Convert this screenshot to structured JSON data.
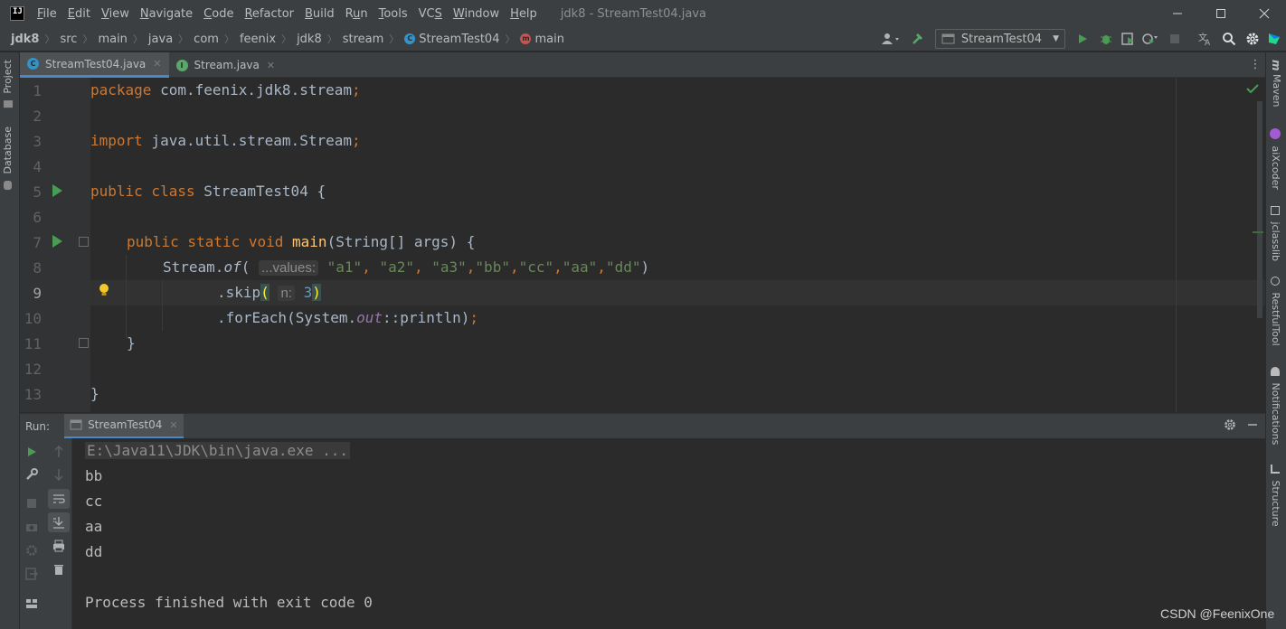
{
  "menubar": {
    "logo": "IJ",
    "items": [
      "File",
      "Edit",
      "View",
      "Navigate",
      "Code",
      "Refactor",
      "Build",
      "Run",
      "Tools",
      "VCS",
      "Window",
      "Help"
    ],
    "mnemonics": [
      "F",
      "E",
      "V",
      "N",
      "C",
      "R",
      "B",
      "u",
      "T",
      "S",
      "W",
      "H"
    ],
    "window_title": "jdk8 - StreamTest04.java"
  },
  "breadcrumb": [
    "jdk8",
    "src",
    "main",
    "java",
    "com",
    "feenix",
    "jdk8",
    "stream",
    "StreamTest04",
    "main"
  ],
  "toolbar": {
    "run_config": "StreamTest04"
  },
  "left_stripe": {
    "project": "Project",
    "database": "Database"
  },
  "right_stripe": {
    "maven": "Maven",
    "aixcoder": "aiXcoder",
    "jclasslib": "jclasslib",
    "restful": "RestfulTool",
    "notifications": "Notifications",
    "structure": "Structure"
  },
  "editor_tabs": [
    {
      "label": "StreamTest04.java",
      "icon": "class-icon",
      "active": true
    },
    {
      "label": "Stream.java",
      "icon": "interface-icon",
      "active": false
    }
  ],
  "code": {
    "line_numbers": [
      "1",
      "2",
      "3",
      "4",
      "5",
      "6",
      "7",
      "8",
      "9",
      "10",
      "11",
      "12",
      "13"
    ],
    "l1_kw": "package",
    "l1_rest": " com.feenix.jdk8.stream",
    "l1_semi": ";",
    "l3_kw": "import",
    "l3_rest": " java.util.stream.Stream",
    "l3_semi": ";",
    "l5_kw": "public class",
    "l5_rest": " StreamTest04 {",
    "l7_kw": "public static void",
    "l7_fn": "main",
    "l7_rest": "(String[] args) {",
    "l8_a": "Stream.",
    "l8_of": "of",
    "l8_paren": "(",
    "l8_hint": "...values:",
    "l8_s1": "\"a1\"",
    "l8_c1": ", ",
    "l8_s2": "\"a2\"",
    "l8_c2": ", ",
    "l8_s3": "\"a3\"",
    "l8_c3": ",",
    "l8_s4": "\"bb\"",
    "l8_c4": ",",
    "l8_s5": "\"cc\"",
    "l8_c5": ",",
    "l8_s6": "\"aa\"",
    "l8_c6": ",",
    "l8_s7": "\"dd\"",
    "l8_end": ")",
    "l9_a": ".skip",
    "l9_open": "(",
    "l9_hint": "n:",
    "l9_num": "3",
    "l9_close": ")",
    "l10_a": ".forEach(System.",
    "l10_out": "out",
    "l10_b": "::println)",
    "l10_semi": ";",
    "l11": "}",
    "l13": "}"
  },
  "run_panel": {
    "label": "Run:",
    "tab": "StreamTest04",
    "console": [
      "E:\\Java11\\JDK\\bin\\java.exe ...",
      "bb",
      "cc",
      "aa",
      "dd",
      "",
      "Process finished with exit code 0"
    ]
  },
  "watermark": "CSDN @FeenixOne",
  "colors": {
    "keyword": "#cc7832",
    "string": "#6a8759",
    "method": "#ffc66d",
    "static_field": "#9876aa",
    "number": "#6897bb",
    "run_green": "#499c54"
  }
}
